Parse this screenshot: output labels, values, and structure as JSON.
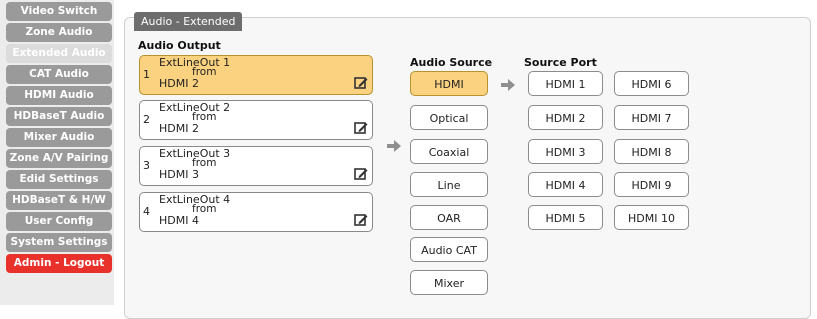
{
  "sidebar": {
    "items": [
      {
        "label": "Video Switch",
        "state": "normal"
      },
      {
        "label": "Zone Audio",
        "state": "normal"
      },
      {
        "label": "Extended Audio",
        "state": "active"
      },
      {
        "label": "CAT Audio",
        "state": "normal"
      },
      {
        "label": "HDMI Audio",
        "state": "normal"
      },
      {
        "label": "HDBaseT Audio",
        "state": "normal"
      },
      {
        "label": "Mixer Audio",
        "state": "normal"
      },
      {
        "label": "Zone A/V Pairing",
        "state": "normal"
      },
      {
        "label": "Edid Settings",
        "state": "normal"
      },
      {
        "label": "HDBaseT & H/W",
        "state": "normal"
      },
      {
        "label": "User Config",
        "state": "normal"
      },
      {
        "label": "System Settings",
        "state": "normal"
      },
      {
        "label": "Admin - Logout",
        "state": "logout"
      }
    ]
  },
  "panel": {
    "tab_title": "Audio - Extended",
    "audio_output_label": "Audio Output",
    "audio_source_label": "Audio Source",
    "source_port_label": "Source Port"
  },
  "outputs": [
    {
      "index": "1",
      "name": "ExtLineOut 1",
      "from_label": "from",
      "source": "HDMI 2",
      "selected": true
    },
    {
      "index": "2",
      "name": "ExtLineOut 2",
      "from_label": "from",
      "source": "HDMI 2",
      "selected": false
    },
    {
      "index": "3",
      "name": "ExtLineOut 3",
      "from_label": "from",
      "source": "HDMI 3",
      "selected": false
    },
    {
      "index": "4",
      "name": "ExtLineOut 4",
      "from_label": "from",
      "source": "HDMI 4",
      "selected": false
    }
  ],
  "audio_sources": [
    {
      "label": "HDMI",
      "selected": true
    },
    {
      "label": "Optical",
      "selected": false
    },
    {
      "label": "Coaxial",
      "selected": false
    },
    {
      "label": "Line",
      "selected": false
    },
    {
      "label": "OAR",
      "selected": false
    },
    {
      "label": "Audio CAT",
      "selected": false
    },
    {
      "label": "Mixer",
      "selected": false
    }
  ],
  "source_ports": {
    "left": [
      "HDMI 1",
      "HDMI 2",
      "HDMI 3",
      "HDMI 4",
      "HDMI 5"
    ],
    "right": [
      "HDMI 6",
      "HDMI 7",
      "HDMI 8",
      "HDMI 9",
      "HDMI 10"
    ]
  },
  "colors": {
    "selected": "#fbd27f",
    "sidebar_item": "#9a9a9a",
    "logout": "#e8312b",
    "arrow": "#8f8f8f"
  },
  "icons": {
    "edit": "edit-icon",
    "arrow": "arrow-right-icon"
  }
}
